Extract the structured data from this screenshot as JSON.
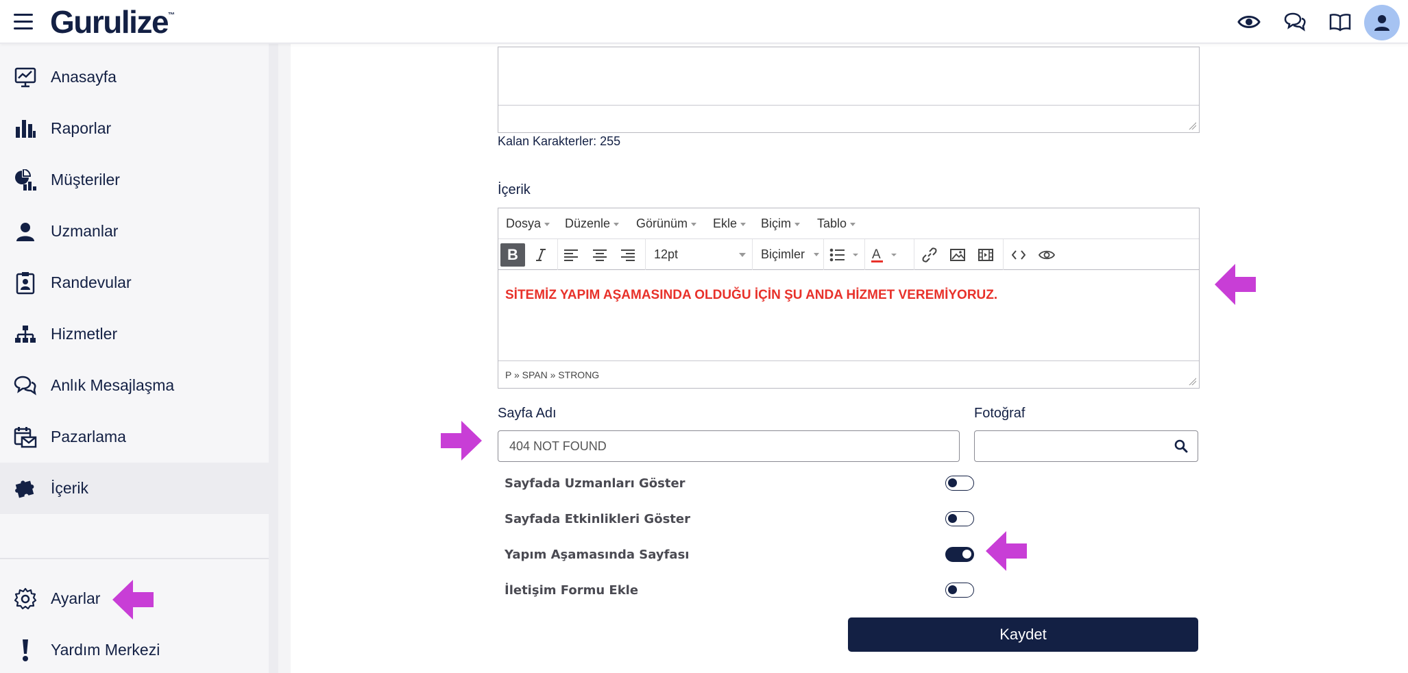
{
  "header": {
    "logo_text": "Gurulize",
    "logo_tm": "™",
    "icons": [
      "eye-icon",
      "chat-icon",
      "book-icon",
      "user-icon"
    ]
  },
  "sidebar": {
    "items": [
      {
        "label": "Anasayfa",
        "icon": "dashboard-icon"
      },
      {
        "label": "Raporlar",
        "icon": "bar-chart-icon"
      },
      {
        "label": "Müşteriler",
        "icon": "customers-icon"
      },
      {
        "label": "Uzmanlar",
        "icon": "expert-icon"
      },
      {
        "label": "Randevular",
        "icon": "appointment-icon"
      },
      {
        "label": "Hizmetler",
        "icon": "hierarchy-icon"
      },
      {
        "label": "Anlık Mesajlaşma",
        "icon": "chat-icon"
      },
      {
        "label": "Pazarlama",
        "icon": "marketing-icon"
      },
      {
        "label": "İçerik",
        "icon": "puzzle-icon"
      }
    ],
    "active_item": "İçerik",
    "bottom": [
      {
        "label": "Ayarlar",
        "icon": "gear-icon"
      },
      {
        "label": "Yardım Merkezi",
        "icon": "exclamation-icon"
      }
    ]
  },
  "form": {
    "remaining_chars": "Kalan Karakterler: 255",
    "content_label": "İçerik",
    "editor": {
      "menus": [
        "Dosya",
        "Düzenle",
        "Görünüm",
        "Ekle",
        "Biçim",
        "Tablo"
      ],
      "font_size": "12pt",
      "formats_label": "Biçimler",
      "content": "SİTEMİZ YAPIM AŞAMASINDA OLDUĞU İÇİN ŞU ANDA HİZMET VEREMİYORUZ.",
      "path": "P » SPAN » STRONG",
      "content_color": "#e8312a"
    },
    "page_name_label": "Sayfa Adı",
    "page_name_value": "404 NOT FOUND",
    "photo_label": "Fotoğraf",
    "photo_value": "",
    "toggles": [
      {
        "label": "Sayfada Uzmanları Göster",
        "on": false
      },
      {
        "label": "Sayfada Etkinlikleri Göster",
        "on": false
      },
      {
        "label": "Yapım Aşamasında Sayfası",
        "on": true
      },
      {
        "label": "İletişim Formu Ekle",
        "on": false
      }
    ],
    "save_label": "Kaydet"
  },
  "colors": {
    "primary": "#132044",
    "annotation_arrow": "#c83ed6",
    "avatar_bg": "#a6c3f2"
  }
}
